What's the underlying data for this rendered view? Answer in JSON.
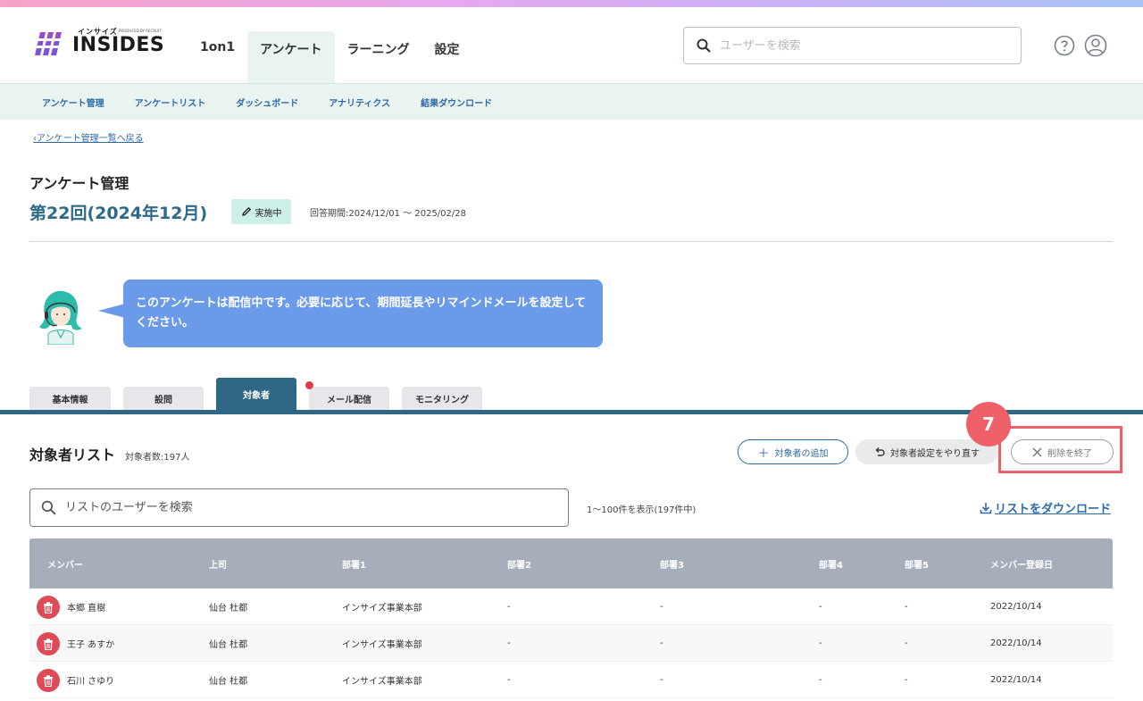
{
  "header": {
    "logo_text": "INSIDES",
    "logo_kana": "インサイズ",
    "logo_sub": "PRODUCED BY RECRUIT",
    "nav": [
      "1on1",
      "アンケート",
      "ラーニング",
      "設定"
    ],
    "active_nav": "アンケート",
    "search_placeholder": "ユーザーを検索"
  },
  "sub_nav": [
    "アンケート管理",
    "アンケートリスト",
    "ダッシュボード",
    "アナリティクス",
    "結果ダウンロード"
  ],
  "back_link": "アンケート管理一覧へ戻る",
  "page_title": "アンケート管理",
  "survey": {
    "title": "第22回(2024年12月)",
    "status": "実施中",
    "period": "回答期間:2024/12/01 〜 2025/02/28"
  },
  "balloon_text": "このアンケートは配信中です。必要に応じて、期間延長やリマインドメールを設定してください。",
  "tabs": [
    "基本情報",
    "設問",
    "対象者",
    "メール配信",
    "モニタリング"
  ],
  "active_tab": "対象者",
  "list": {
    "title": "対象者リスト",
    "count": "対象者数:197人",
    "add_button": "対象者の追加",
    "reset_button": "対象者設定をやり直す",
    "end_delete_button": "削除を終了",
    "search_placeholder": "リストのユーザーを検索",
    "display_count": "1〜100件を表示(197件中)",
    "download_link": "リストをダウンロード"
  },
  "annotation": {
    "step": "7",
    "color": "#ee5f6a"
  },
  "table": {
    "columns": [
      "メンバー",
      "上司",
      "部署1",
      "部署2",
      "部署3",
      "部署4",
      "部署5",
      "メンバー登録日"
    ],
    "rows": [
      [
        "本郷 直樹",
        "仙台 杜都",
        "インサイズ事業本部",
        "-",
        "-",
        "-",
        "-",
        "2022/10/14"
      ],
      [
        "王子 あすか",
        "仙台 杜都",
        "インサイズ事業本部",
        "-",
        "-",
        "-",
        "-",
        "2022/10/14"
      ],
      [
        "石川 さゆり",
        "仙台 杜都",
        "インサイズ事業本部",
        "-",
        "-",
        "-",
        "-",
        "2022/10/14"
      ]
    ]
  },
  "colors": {
    "primary": "#2f6784",
    "link": "#2d6aa8",
    "balloon": "#6b9be8",
    "subnav_bg": "#e9f3ef",
    "delete": "#e04a57"
  }
}
